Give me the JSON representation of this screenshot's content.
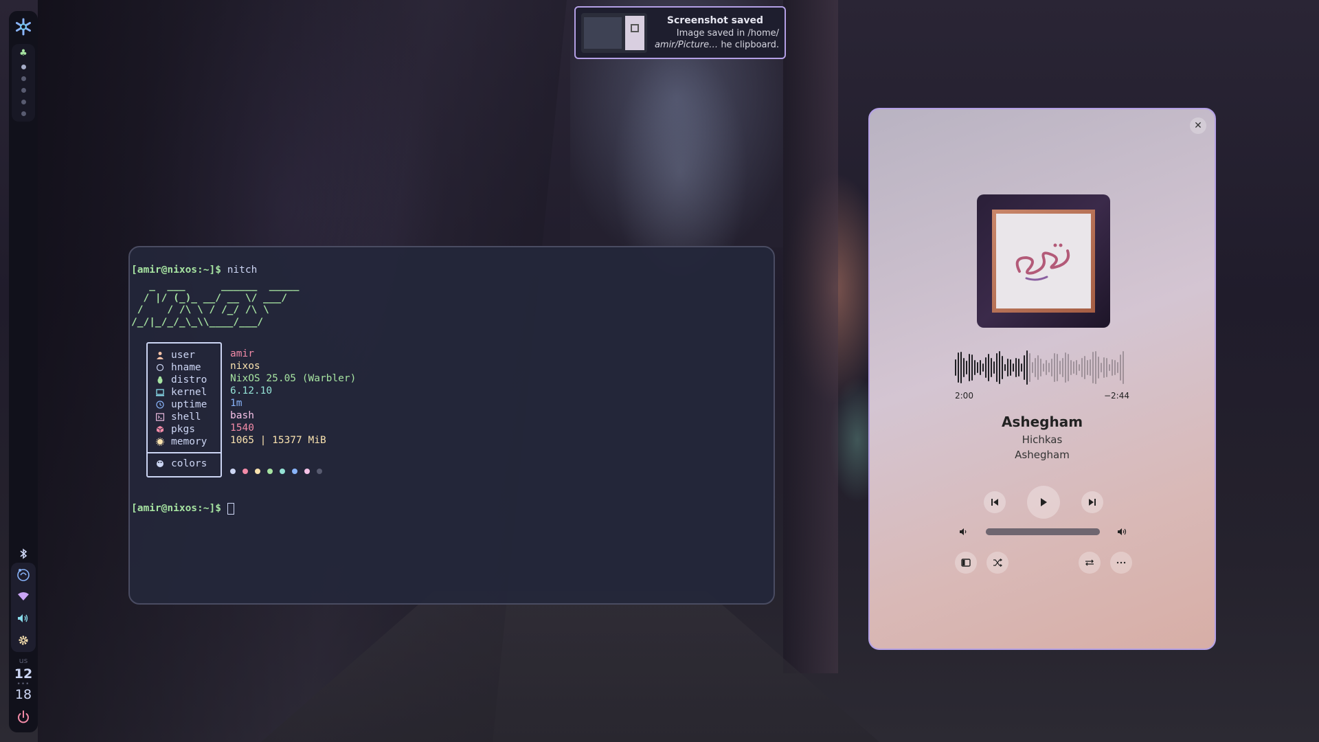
{
  "notification": {
    "title": "Screenshot saved",
    "body_line1": "Image saved in /home/",
    "body_line2_path": "amir/Picture…",
    "body_line2_rest": " he clipboard."
  },
  "bar": {
    "keyboard_layout": "us",
    "clock_hour": "12",
    "clock_minute": "18",
    "workspaces": [
      {
        "type": "leaf"
      },
      {
        "type": "dot",
        "active": true
      },
      {
        "type": "dot",
        "active": false
      },
      {
        "type": "dot",
        "active": false
      },
      {
        "type": "dot",
        "active": false
      },
      {
        "type": "dot",
        "active": false
      }
    ]
  },
  "terminal": {
    "prompt": "[amir@nixos:~]$",
    "command": "nitch",
    "ascii_art": [
      "   _  ___      ______  _____",
      "  / |/ (_)_ __/ __ \\/ ___/",
      " /    / /\\ \\ / /_/ /\\ \\",
      "/_/|_/_/_\\_\\\\____/___/"
    ],
    "info": [
      {
        "label": "user",
        "value": "amir",
        "icon": "user-icon",
        "color": "#f5c2a7",
        "value_color": "#f38ba8"
      },
      {
        "label": "hname",
        "value": "nixos",
        "icon": "host-icon",
        "color": "#cdd6f4",
        "value_color": "#f9e2af"
      },
      {
        "label": "distro",
        "value": "NixOS 25.05 (Warbler)",
        "icon": "linux-icon",
        "color": "#a6e3a1",
        "value_color": "#a6e3a1"
      },
      {
        "label": "kernel",
        "value": "6.12.10",
        "icon": "kernel-icon",
        "color": "#89dceb",
        "value_color": "#94e2d5"
      },
      {
        "label": "uptime",
        "value": "1m",
        "icon": "clock-icon",
        "color": "#89b4fa",
        "value_color": "#89b4fa"
      },
      {
        "label": "shell",
        "value": "bash",
        "icon": "shell-icon",
        "color": "#f5c2e7",
        "value_color": "#f5c2e7"
      },
      {
        "label": "pkgs",
        "value": "1540",
        "icon": "package-icon",
        "color": "#f38ba8",
        "value_color": "#f38ba8"
      },
      {
        "label": "memory",
        "value": "1065 | 15377 MiB",
        "icon": "memory-icon",
        "color": "#f9e2af",
        "value_color": "#f9e2af"
      }
    ],
    "colors_label": "colors",
    "color_swatches": [
      "#cdd6f4",
      "#f38ba8",
      "#f9e2af",
      "#a6e3a1",
      "#94e2d5",
      "#89b4fa",
      "#f5c2e7",
      "#585b70"
    ]
  },
  "player": {
    "elapsed": "2:00",
    "remaining": "−2:44",
    "progress": 0.42,
    "title": "Ashegham",
    "artist": "Hichkas",
    "album": "Ashegham",
    "volume": 1.0
  }
}
